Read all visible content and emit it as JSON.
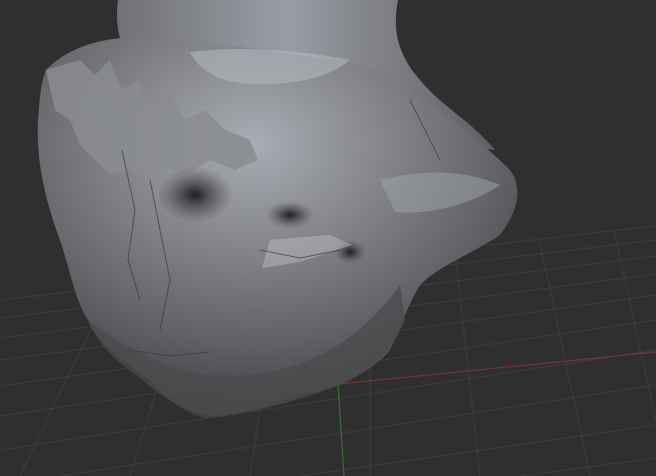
{
  "viewport": {
    "background_color": "#2f2f2f",
    "grid_color": "#3d3d3d",
    "mesh_base_color": "#6d6d6f",
    "mesh_highlight_color": "#a9acb3",
    "mesh_shadow_color": "#3c3c3e",
    "axis_x_color": "#7a3434",
    "axis_y_color": "#3a6d3a",
    "grid_visible": true,
    "object": "sculpted-mesh"
  }
}
